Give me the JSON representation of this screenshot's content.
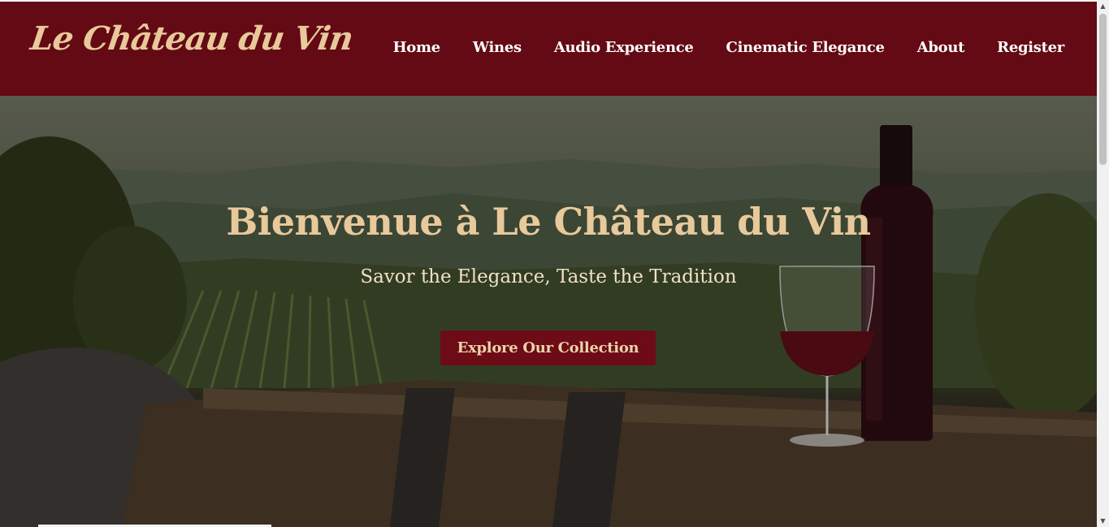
{
  "header": {
    "logo": "Le Château du Vin",
    "nav": [
      {
        "label": "Home"
      },
      {
        "label": "Wines"
      },
      {
        "label": "Audio Experience"
      },
      {
        "label": "Cinematic Elegance"
      },
      {
        "label": "About"
      },
      {
        "label": "Register"
      }
    ]
  },
  "hero": {
    "title": "Bienvenue à Le Château du Vin",
    "subtitle": "Savor the Elegance, Taste the Tradition",
    "cta_label": "Explore Our Collection"
  },
  "colors": {
    "nav_background": "#630a14",
    "logo": "#e9c99b",
    "hero_title": "#e8c99c",
    "cta_background": "#6d0b17",
    "cta_text": "#ecd3a8"
  },
  "icons": [
    "scroll-up-arrow-icon",
    "scroll-down-arrow-icon"
  ]
}
